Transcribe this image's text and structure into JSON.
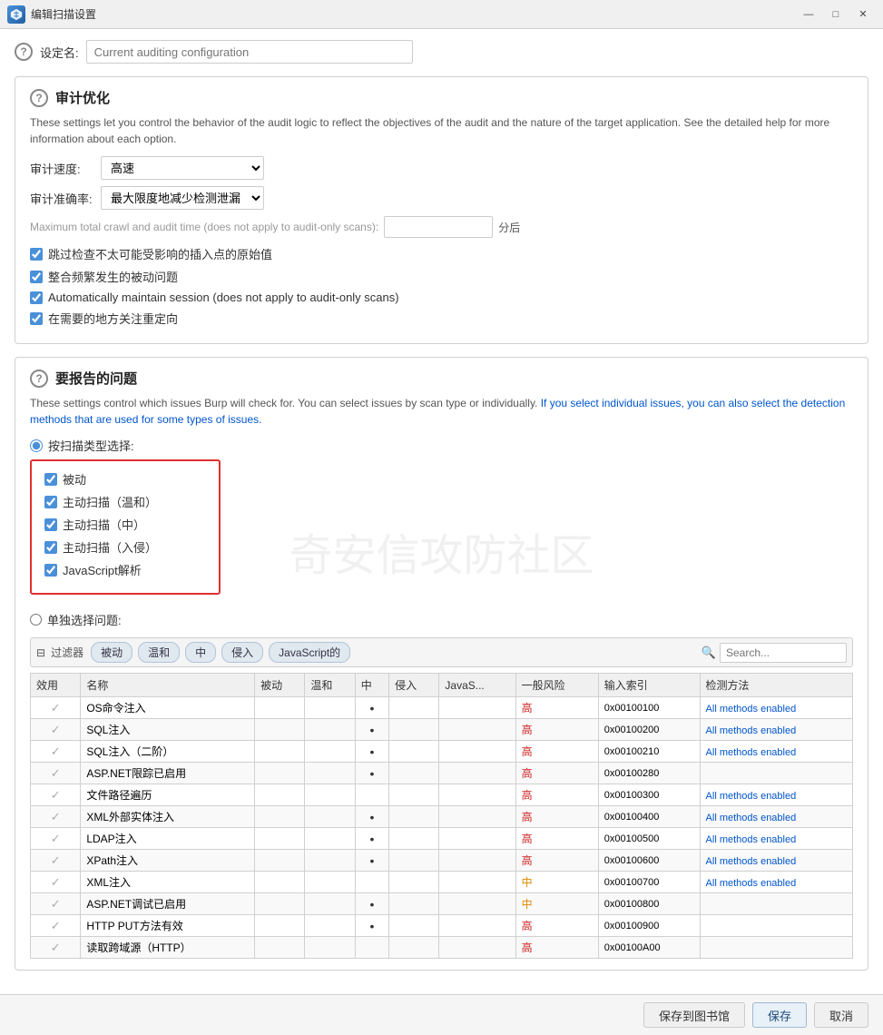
{
  "window": {
    "title": "编辑扫描设置",
    "minimize_label": "—",
    "maximize_label": "□",
    "close_label": "✕"
  },
  "name_field": {
    "label": "设定名:",
    "placeholder": "Current auditing configuration"
  },
  "audit_optimization": {
    "title": "审计优化",
    "description": "These settings let you control the behavior of the audit logic to reflect the objectives of the audit and the nature of the target application. See the detailed help for more information about each option.",
    "speed_label": "审计速度:",
    "speed_value": "高速",
    "accuracy_label": "审计准确率:",
    "accuracy_value": "最大限度地减少检测泄漏",
    "crawl_time_label": "Maximum total crawl and audit time (does not apply to audit-only scans):",
    "crawl_time_suffix": "分后",
    "checkboxes": [
      {
        "id": "cb1",
        "label": "跳过检查不太可能受影响的插入点的原始值",
        "checked": true
      },
      {
        "id": "cb2",
        "label": "整合频繁发生的被动问题",
        "checked": true
      },
      {
        "id": "cb3",
        "label": "Automatically maintain session (does not apply to audit-only scans)",
        "checked": true
      },
      {
        "id": "cb4",
        "label": "在需要的地方关注重定向",
        "checked": true
      }
    ]
  },
  "issues": {
    "title": "要报告的问题",
    "description_part1": "These settings control which issues Burp will check for. You can select issues by scan type or individually.",
    "description_part2": " If you select individual issues, you can also select the detection methods that are used for some types of issues.",
    "scan_type_label": "按扫描类型选择:",
    "scan_types": [
      {
        "id": "st1",
        "label": "被动",
        "checked": true
      },
      {
        "id": "st2",
        "label": "主动扫描（温和）",
        "checked": true
      },
      {
        "id": "st3",
        "label": "主动扫描（中）",
        "checked": true
      },
      {
        "id": "st4",
        "label": "主动扫描（入侵）",
        "checked": true
      },
      {
        "id": "st5",
        "label": "JavaScript解析",
        "checked": true
      }
    ],
    "single_select_label": "单独选择问题:",
    "filter_chips": [
      "过滤器",
      "被动",
      "温和",
      "中",
      "侵入",
      "JavaScript的"
    ],
    "search_placeholder": "Search...",
    "table_headers": [
      "效用",
      "名称",
      "被动",
      "温和",
      "中",
      "侵入",
      "JavaS...",
      "一般风险",
      "输入索引",
      "检测方法"
    ],
    "table_rows": [
      {
        "name": "OS命令注入",
        "passive": "",
        "mild": "",
        "medium": "•",
        "intrusive": "",
        "js": "",
        "risk": "高",
        "index": "0x00100100",
        "methods": "All methods enabled"
      },
      {
        "name": "SQL注入",
        "passive": "",
        "mild": "",
        "medium": "•",
        "intrusive": "",
        "js": "",
        "risk": "高",
        "index": "0x00100200",
        "methods": "All methods enabled"
      },
      {
        "name": "SQL注入（二阶）",
        "passive": "",
        "mild": "",
        "medium": "•",
        "intrusive": "",
        "js": "",
        "risk": "高",
        "index": "0x00100210",
        "methods": "All methods enabled"
      },
      {
        "name": "ASP.NET限踪已启用",
        "passive": "",
        "mild": "",
        "medium": "•",
        "intrusive": "",
        "js": "",
        "risk": "高",
        "index": "0x00100280",
        "methods": ""
      },
      {
        "name": "文件路径遍历",
        "passive": "",
        "mild": "",
        "medium": "",
        "intrusive": "",
        "js": "",
        "risk": "高",
        "index": "0x00100300",
        "methods": "All methods enabled"
      },
      {
        "name": "XML外部实体注入",
        "passive": "",
        "mild": "",
        "medium": "•",
        "intrusive": "",
        "js": "",
        "risk": "高",
        "index": "0x00100400",
        "methods": "All methods enabled"
      },
      {
        "name": "LDAP注入",
        "passive": "",
        "mild": "",
        "medium": "•",
        "intrusive": "",
        "js": "",
        "risk": "高",
        "index": "0x00100500",
        "methods": "All methods enabled"
      },
      {
        "name": "XPath注入",
        "passive": "",
        "mild": "",
        "medium": "•",
        "intrusive": "",
        "js": "",
        "risk": "高",
        "index": "0x00100600",
        "methods": "All methods enabled"
      },
      {
        "name": "XML注入",
        "passive": "",
        "mild": "",
        "medium": "",
        "intrusive": "",
        "js": "",
        "risk": "中",
        "index": "0x00100700",
        "methods": "All methods enabled"
      },
      {
        "name": "ASP.NET调试已启用",
        "passive": "",
        "mild": "",
        "medium": "•",
        "intrusive": "",
        "js": "",
        "risk": "中",
        "index": "0x00100800",
        "methods": ""
      },
      {
        "name": "HTTP PUT方法有效",
        "passive": "",
        "mild": "",
        "medium": "•",
        "intrusive": "",
        "js": "",
        "risk": "高",
        "index": "0x00100900",
        "methods": ""
      },
      {
        "name": "读取跨域源（HTTP）",
        "passive": "",
        "mild": "",
        "medium": "",
        "intrusive": "",
        "js": "",
        "risk": "高",
        "index": "0x00100A00",
        "methods": ""
      }
    ]
  },
  "buttons": {
    "save_to_library": "保存到图书馆",
    "save": "保存",
    "cancel": "取消"
  },
  "watermark": "奇安信攻防社区"
}
